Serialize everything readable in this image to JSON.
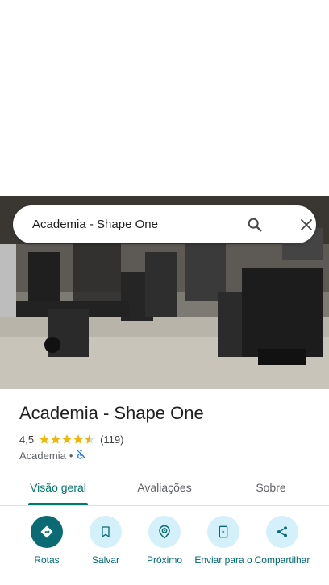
{
  "search": {
    "query": "Academia - Shape One"
  },
  "place": {
    "name": "Academia - Shape One",
    "rating": "4,5",
    "stars": 4.5,
    "review_count": "(119)",
    "category": "Academia",
    "separator": "•"
  },
  "tabs": [
    {
      "label": "Visão geral",
      "active": true
    },
    {
      "label": "Avaliações",
      "active": false
    },
    {
      "label": "Sobre",
      "active": false
    }
  ],
  "actions": [
    {
      "label": "Rotas",
      "icon": "directions-icon"
    },
    {
      "label": "Salvar",
      "icon": "bookmark-icon"
    },
    {
      "label": "Próximo",
      "icon": "nearby-icon"
    },
    {
      "label": "Enviar para o",
      "icon": "send-to-phone-icon"
    },
    {
      "label": "Compartilhar",
      "icon": "share-icon"
    }
  ],
  "colors": {
    "accent": "#00796b",
    "primary_action_bg": "#0b6b75",
    "secondary_action_bg": "#d3f0fb",
    "star": "#f4b400"
  }
}
